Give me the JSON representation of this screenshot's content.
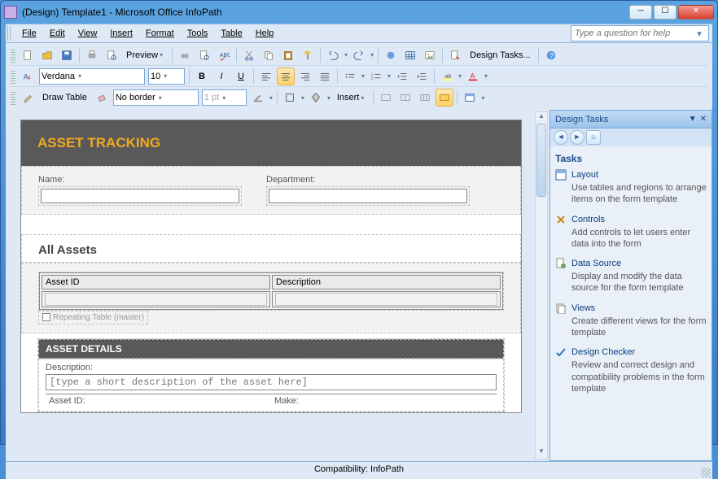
{
  "window": {
    "title": "(Design) Template1 - Microsoft Office InfoPath"
  },
  "menu": {
    "file": "File",
    "edit": "Edit",
    "view": "View",
    "insert": "Insert",
    "format": "Format",
    "tools": "Tools",
    "table": "Table",
    "help": "Help"
  },
  "help_box": {
    "placeholder": "Type a question for help"
  },
  "toolbar": {
    "preview": "Preview",
    "design_tasks": "Design Tasks...",
    "font_name": "Verdana",
    "font_size": "10",
    "draw_table": "Draw Table",
    "border_style": "No border",
    "border_width": "1 pt",
    "insert": "Insert"
  },
  "form": {
    "title": "ASSET TRACKING",
    "name_label": "Name:",
    "dept_label": "Department:",
    "all_assets": "All Assets",
    "asset_id_col": "Asset ID",
    "desc_col": "Description",
    "repeat_hint": "Repeating Table (master)",
    "details_header": "ASSET DETAILS",
    "desc_label": "Description:",
    "desc_placeholder": "[type a short description of the asset here]",
    "asset_id_label": "Asset ID:",
    "make_label": "Make:"
  },
  "taskpane": {
    "title": "Design Tasks",
    "section": "Tasks",
    "items": [
      {
        "label": "Layout",
        "desc": "Use tables and regions to arrange items on the form template"
      },
      {
        "label": "Controls",
        "desc": "Add controls to let users enter data into the form"
      },
      {
        "label": "Data Source",
        "desc": "Display and modify the data source for the form template"
      },
      {
        "label": "Views",
        "desc": "Create different views for the form template"
      },
      {
        "label": "Design Checker",
        "desc": "Review and correct design and compatibility problems in the form template"
      }
    ]
  },
  "status": {
    "compat": "Compatibility: InfoPath"
  }
}
